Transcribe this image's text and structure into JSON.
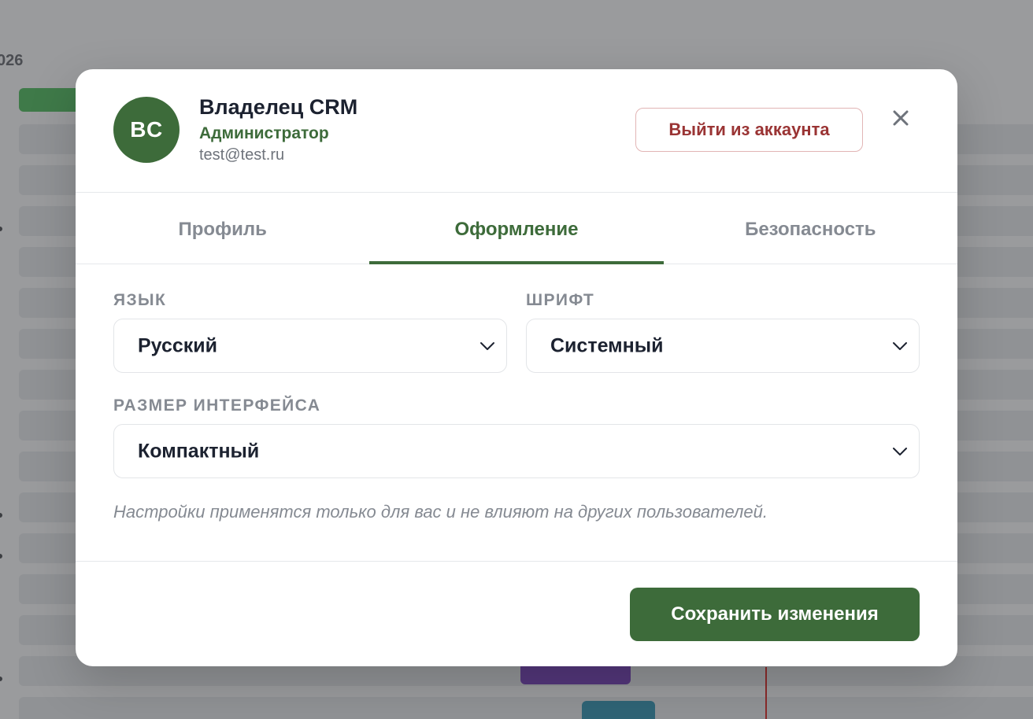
{
  "background": {
    "year_fragment": "026"
  },
  "user": {
    "initials": "BC",
    "name": "Владелец CRM",
    "role": "Администратор",
    "email": "test@test.ru"
  },
  "header": {
    "logout_label": "Выйти из аккаунта",
    "close_icon": "close-icon"
  },
  "tabs": [
    {
      "label": "Профиль",
      "active": false
    },
    {
      "label": "Оформление",
      "active": true
    },
    {
      "label": "Безопасность",
      "active": false
    }
  ],
  "fields": {
    "language": {
      "label": "ЯЗЫК",
      "value": "Русский"
    },
    "font": {
      "label": "ШРИФТ",
      "value": "Системный"
    },
    "interface_size": {
      "label": "РАЗМЕР ИНТЕРФЕЙСА",
      "value": "Компактный"
    }
  },
  "hint": "Настройки применятся только для вас и не влияют на других пользователей.",
  "footer": {
    "save_label": "Сохранить изменения"
  },
  "colors": {
    "accent": "#3d6b3a",
    "danger": "#9a3434",
    "overlay": "#9a9b9d"
  }
}
